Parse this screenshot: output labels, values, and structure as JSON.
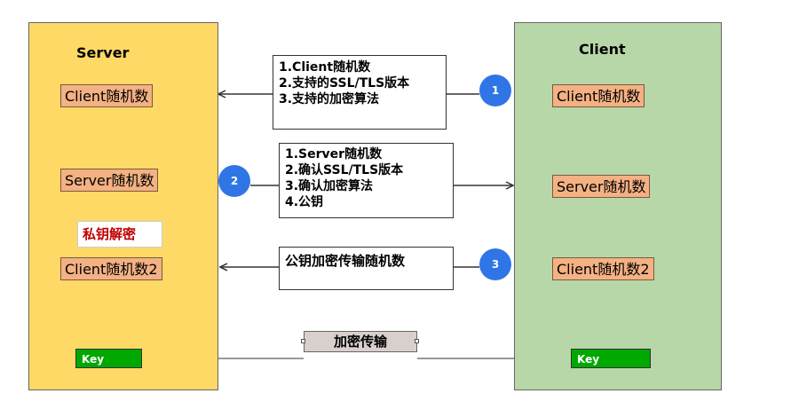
{
  "server": {
    "title": "Server",
    "client_random": "Client随机数",
    "server_random": "Server随机数",
    "decrypt_label": "私钥解密",
    "client_random2": "Client随机数2",
    "key_label": "Key"
  },
  "client": {
    "title": "Client",
    "client_random": "Client随机数",
    "server_random": "Server随机数",
    "client_random2": "Client随机数2",
    "key_label": "Key"
  },
  "steps": [
    {
      "number": "1",
      "lines": [
        "1.Client随机数",
        "2.支持的SSL/TLS版本",
        "3.支持的加密算法"
      ]
    },
    {
      "number": "2",
      "lines": [
        "1.Server随机数",
        "2.确认SSL/TLS版本",
        "3.确认加密算法",
        "4.公钥"
      ]
    },
    {
      "number": "3",
      "lines": [
        "公钥加密传输随机数"
      ]
    }
  ],
  "transfer_label": "加密传输",
  "colors": {
    "server_bg": "#FFD966",
    "client_bg": "#B7D7A8",
    "value_box": "#F4B183",
    "step_circle": "#2F75E6",
    "key_bg": "#00A800",
    "decrypt_text": "#C00000"
  }
}
